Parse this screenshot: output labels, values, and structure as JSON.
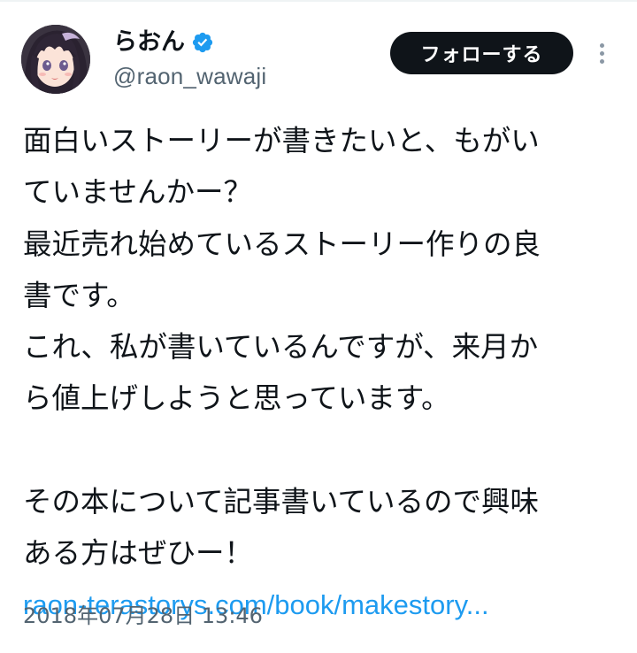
{
  "author": {
    "display_name": "らおん",
    "handle": "@raon_wawaji",
    "verified": true,
    "verified_badge_color": "#1d9bf0",
    "avatar_icon": "anime-girl-avatar"
  },
  "actions": {
    "follow_label": "フォローする",
    "more_icon": "more-vertical-icon"
  },
  "tweet": {
    "lines": [
      "面白いストーリーが書きたいと、もがい",
      "ていませんかー？",
      "最近売れ始めているストーリー作りの良",
      "書です。",
      "これ、私が書いているんですが、来月か",
      "ら値上げしようと思っています。",
      "",
      "その本について記事書いているので興味",
      "ある方はぜひー！"
    ],
    "link_text": "raon-terastorys.com/book/makestory...",
    "timestamp": "2018年07月28日 13:46"
  },
  "colors": {
    "text": "#0f1419",
    "secondary": "#536471",
    "link": "#1d9bf0",
    "button_bg": "#0f1419",
    "button_text": "#ffffff"
  }
}
